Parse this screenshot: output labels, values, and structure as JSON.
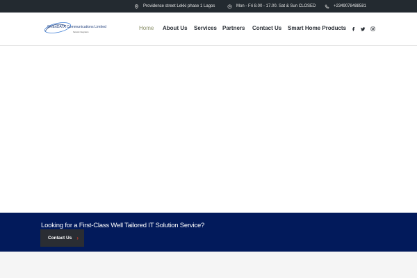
{
  "topbar": {
    "address": "Providence street Lekki phase 1 Lagos",
    "hours": "Mon - Fri 8.00 - 17.00. Sat & Sun CLOSED",
    "phone": "+2349078488581",
    "icons": [
      "location-pin-icon",
      "clock-icon",
      "phone-icon"
    ]
  },
  "header": {
    "logo": {
      "brand": "SmartDATA Communications Limited",
      "tagline": "Network Integration"
    },
    "nav": [
      {
        "label": "Home",
        "active": true
      },
      {
        "label": "About Us"
      },
      {
        "label": "Services"
      },
      {
        "label": "Partners"
      },
      {
        "label": "Contact Us"
      },
      {
        "label": "Smart Home Products"
      }
    ],
    "social": [
      "facebook-icon",
      "twitter-icon",
      "instagram-icon"
    ]
  },
  "cta": {
    "text": "Looking for a First-Class Well Tailored IT Solution Service?",
    "button_label": "Contact Us"
  },
  "colors": {
    "topbar_bg": "#232a30",
    "nav_active": "#8a8f69",
    "cta_bg": "#021a5b",
    "button_bg": "#2a2d33",
    "button_arrow": "#c0392b"
  }
}
